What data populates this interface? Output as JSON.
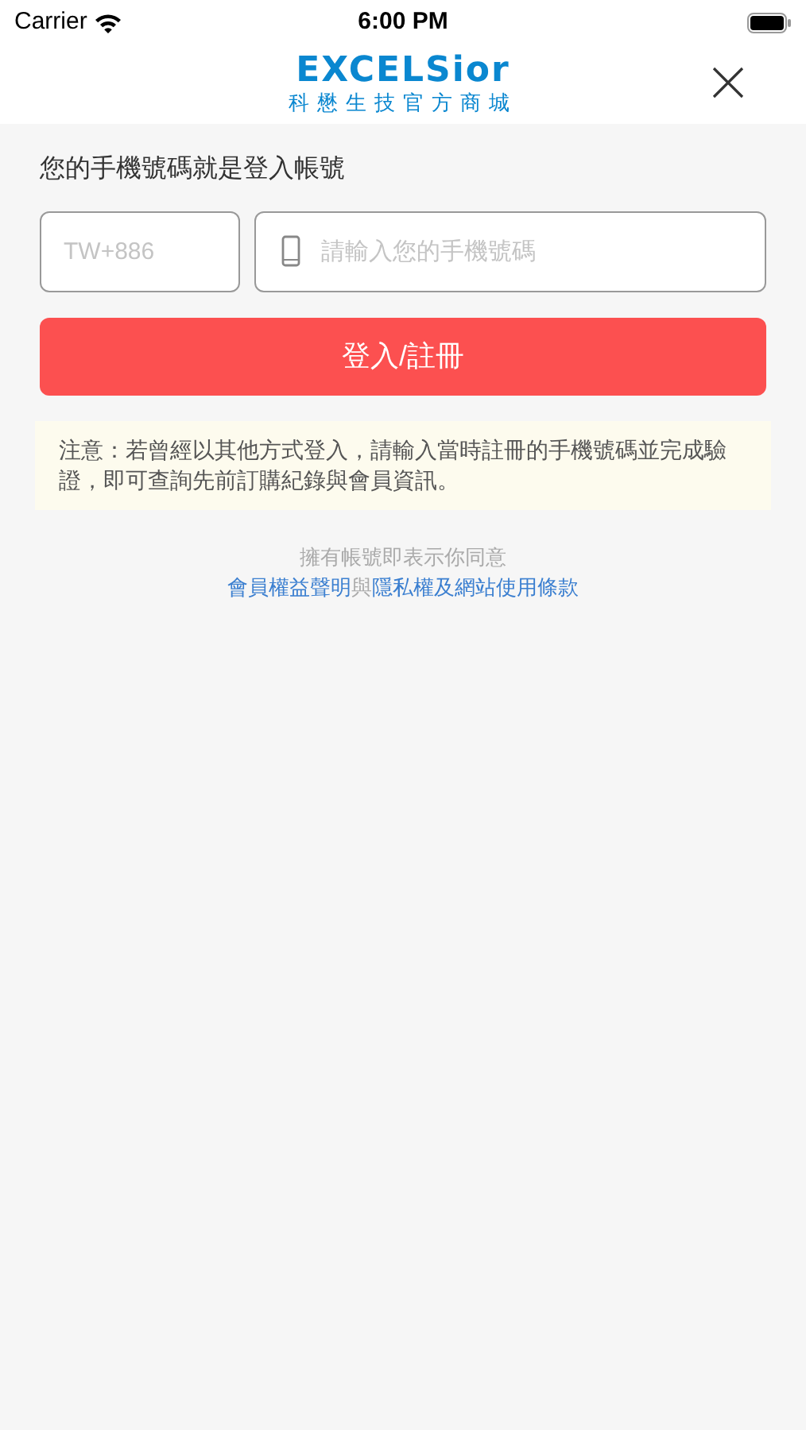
{
  "status_bar": {
    "carrier": "Carrier",
    "time": "6:00 PM"
  },
  "header": {
    "logo": "EXCELSior",
    "tagline": "科懋生技官方商城"
  },
  "prompt": "您的手機號碼就是登入帳號",
  "country_code": {
    "placeholder": "TW+886"
  },
  "phone": {
    "placeholder": "請輸入您的手機號碼"
  },
  "submit_button": "登入/註冊",
  "notice": "注意：若曾經以其他方式登入，請輸入當時註冊的手機號碼並完成驗證，即可查詢先前訂購紀錄與會員資訊。",
  "agreement": {
    "intro": "擁有帳號即表示你同意",
    "parts": [
      {
        "kind": "link",
        "text": "會員權益聲明"
      },
      {
        "kind": "plain",
        "text": "與"
      },
      {
        "kind": "link",
        "text": "隱私權及網站使用條款"
      }
    ]
  }
}
